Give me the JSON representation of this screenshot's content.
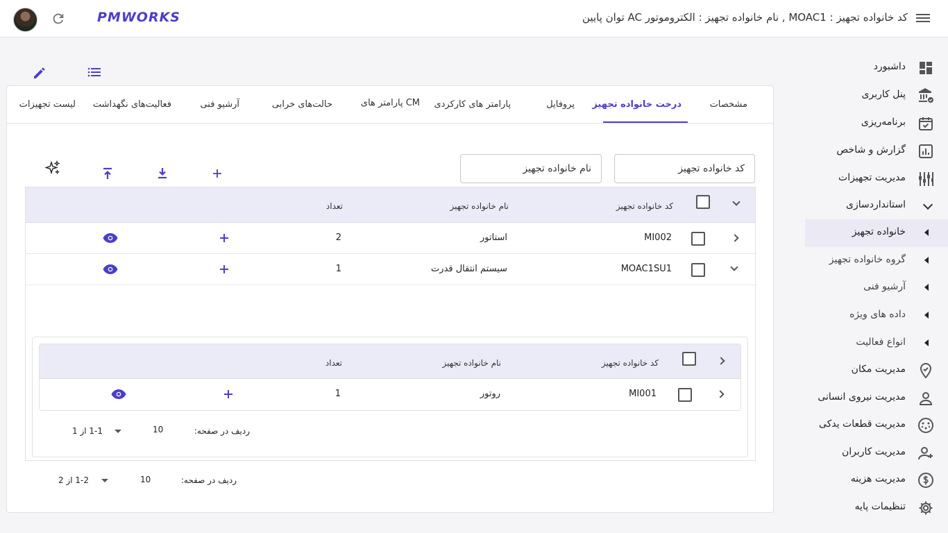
{
  "header": {
    "title": "کد خانواده تجهیز : MOAC1 , نام خانواده تجهیز : الکتروموتور AC توان پایین",
    "logo": "PMWORKS"
  },
  "sidebar": {
    "items": [
      {
        "label": "داشبورد",
        "icon": "dashboard-icon"
      },
      {
        "label": "پنل کاربری",
        "icon": "bank-user-icon"
      },
      {
        "label": "برنامه‌ریزی",
        "icon": "calendar-check-icon"
      },
      {
        "label": "گزارش و شاخص",
        "icon": "bar-chart-icon"
      },
      {
        "label": "مدیریت تجهیزات",
        "icon": "equipment-icon"
      },
      {
        "label": "استانداردسازی",
        "icon": "chevron-down-icon"
      },
      {
        "label": "خانواده تجهیز",
        "icon": "caret-left-icon"
      },
      {
        "label": "گروه خانواده تجهیز",
        "icon": "caret-left-icon"
      },
      {
        "label": "آرشیو فنی",
        "icon": "caret-left-icon"
      },
      {
        "label": "داده های ویژه",
        "icon": "caret-left-icon"
      },
      {
        "label": "انواع فعالیت",
        "icon": "caret-left-icon"
      },
      {
        "label": "مدیریت مکان",
        "icon": "location-icon"
      },
      {
        "label": "مدیریت نیروی انسانی",
        "icon": "person-icon"
      },
      {
        "label": "مدیریت قطعات یدکی",
        "icon": "spare-parts-icon"
      },
      {
        "label": "مدیریت کاربران",
        "icon": "person-add-icon"
      },
      {
        "label": "مدیریت هزینه",
        "icon": "dollar-icon"
      },
      {
        "label": "تنظیمات پایه",
        "icon": "gear-icon"
      }
    ]
  },
  "tabs": [
    {
      "label": "مشخصات"
    },
    {
      "label": "درخت خانواده تجهیز"
    },
    {
      "label": "پروفایل"
    },
    {
      "label": "پارامتر های کارکردی"
    },
    {
      "label": "پارامتر های CM"
    },
    {
      "label": "حالت‌های خرابی"
    },
    {
      "label": "آرشیو فنی"
    },
    {
      "label": "فعالیت‌های نگهداشت"
    },
    {
      "label": "لیست تجهیزات"
    }
  ],
  "filters": {
    "code_placeholder": "کد خانواده تجهیز",
    "name_placeholder": "نام خانواده تجهیز"
  },
  "table": {
    "columns": {
      "code": "کد خانواده تجهیز",
      "name": "نام خانواده تجهیز",
      "count": "تعداد"
    },
    "rows": [
      {
        "code": "MI002",
        "name": "استاتور",
        "count": "2"
      },
      {
        "code": "MOAC1SU1",
        "name": "سیستم انتقال قدرت",
        "count": "1"
      }
    ],
    "pager": {
      "rows_label": "ردیف در صفحه:",
      "rows_value": "10",
      "range": "1-2 از 2"
    }
  },
  "subtable": {
    "columns": {
      "code": "کد خانواده تجهیز",
      "name": "نام خانواده تجهیز",
      "count": "تعداد"
    },
    "rows": [
      {
        "code": "MI001",
        "name": "روتور",
        "count": "1"
      }
    ],
    "pager": {
      "rows_label": "ردیف در صفحه:",
      "rows_value": "10",
      "range": "1-1 از 1"
    }
  },
  "colors": {
    "accent": "#4b3ec8",
    "header_bg": "#ebebf7"
  }
}
